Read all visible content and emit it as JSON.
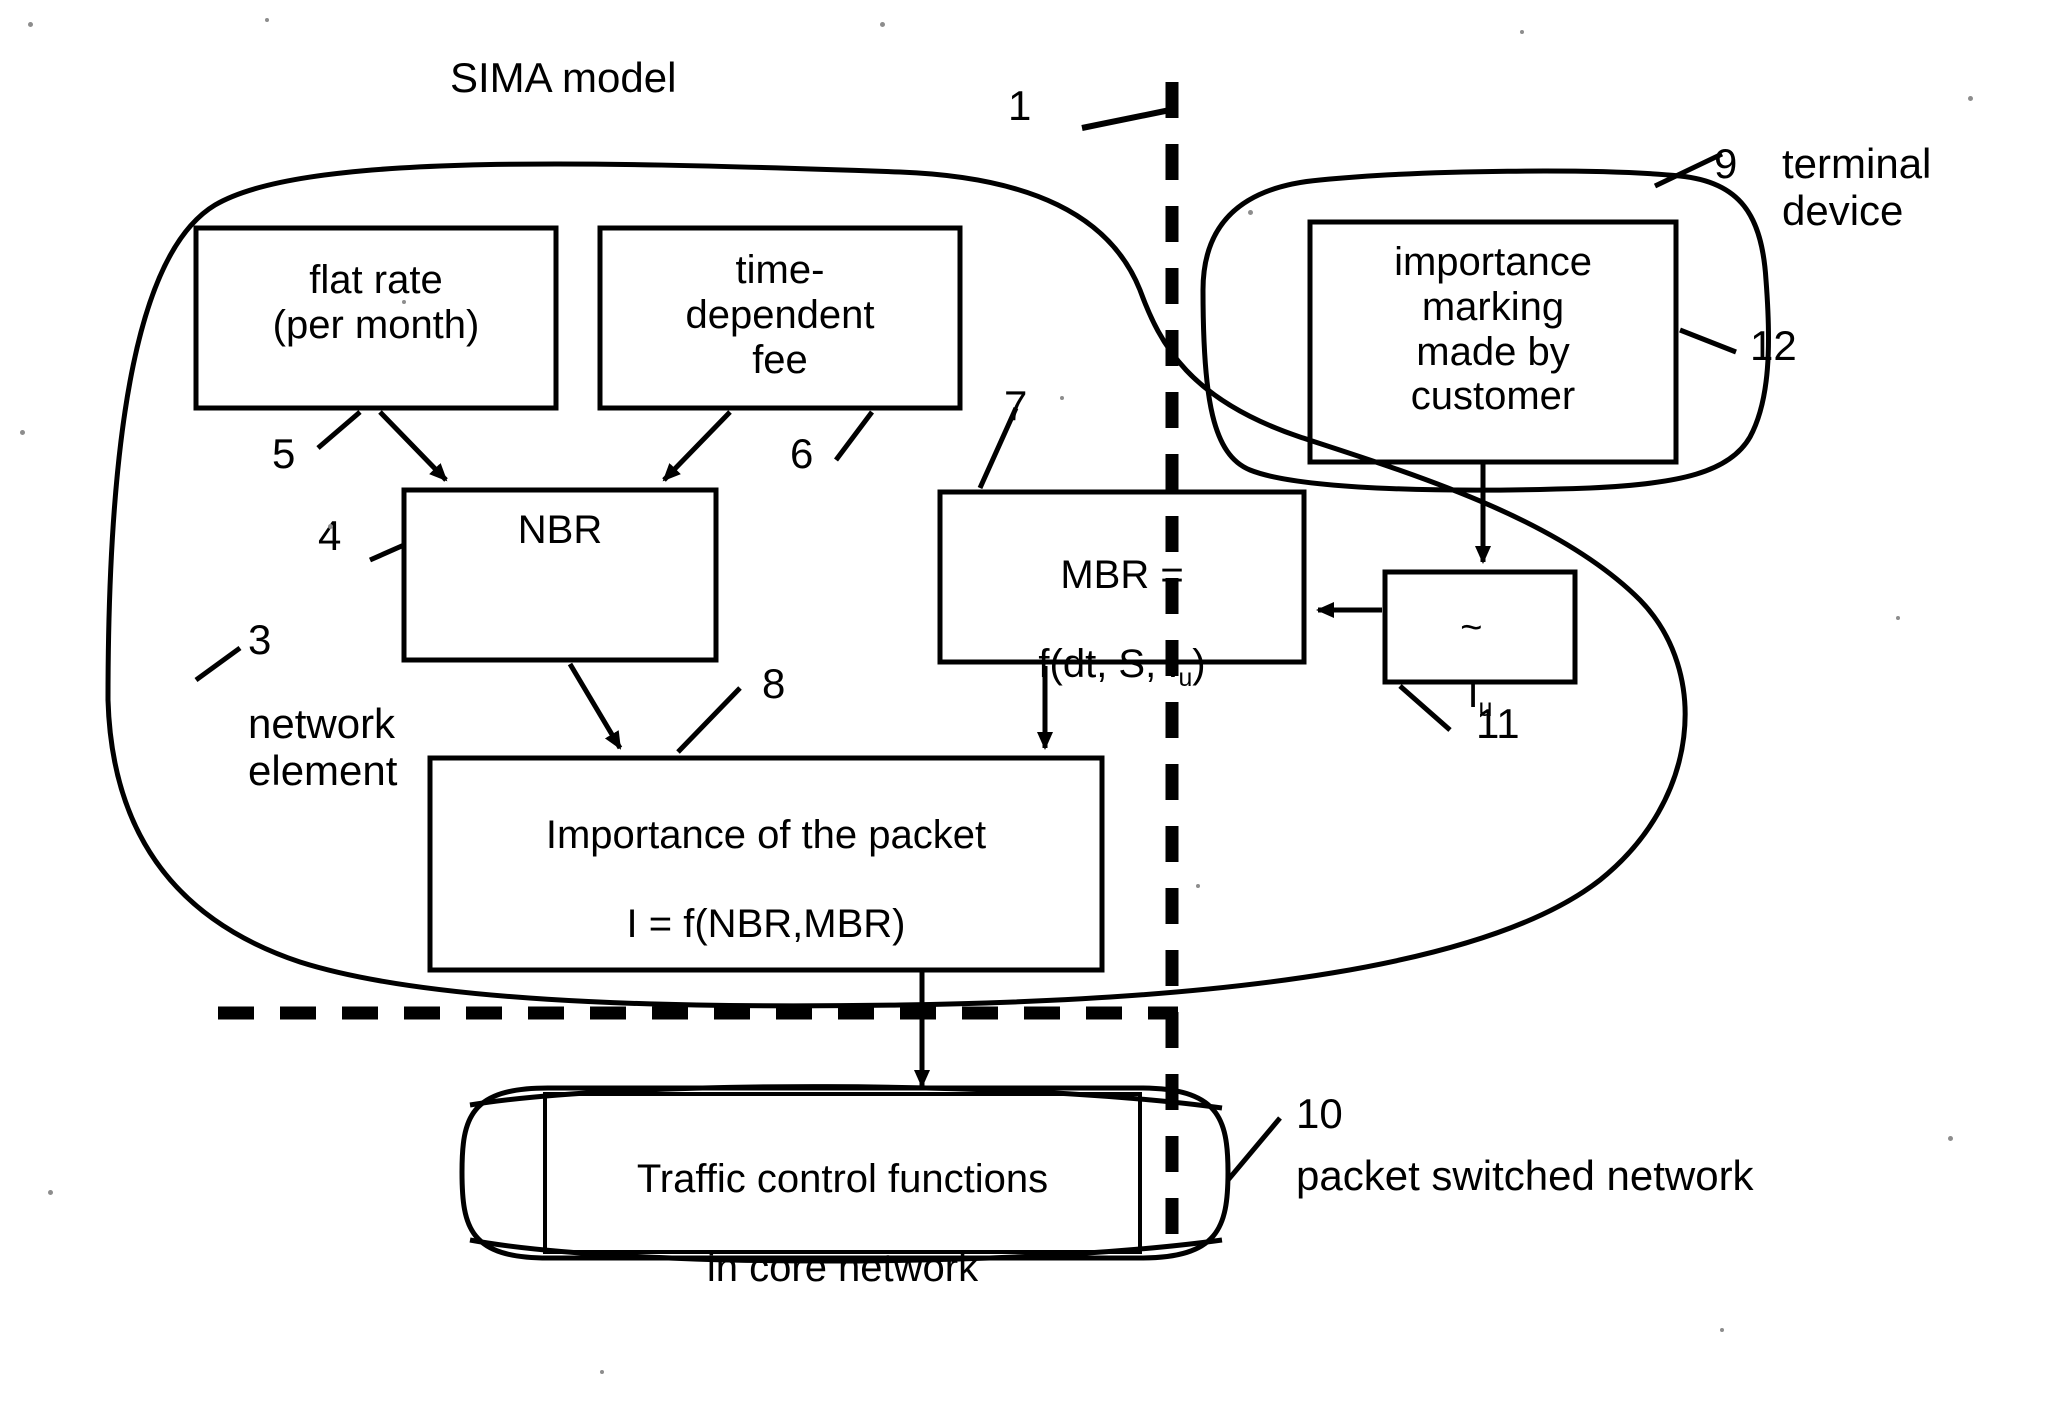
{
  "figure": {
    "title": "SIMA model",
    "type": "block-diagram"
  },
  "labels": {
    "sima_model": "SIMA model",
    "ref_1": "1",
    "ref_3": "3",
    "network_element": "network\nelement",
    "ref_4": "4",
    "ref_5": "5",
    "ref_6": "6",
    "ref_7": "7",
    "ref_8": "8",
    "ref_9": "9",
    "terminal_device": "terminal\ndevice",
    "ref_10": "10",
    "packet_switched_network": "packet switched network",
    "ref_11": "11",
    "ref_12": "12"
  },
  "boxes": {
    "flat_rate": {
      "text": "flat rate\n(per month)",
      "ref": "5"
    },
    "time_dependent_fee": {
      "text": "time-\ndependent\nfee",
      "ref": "6"
    },
    "nbr": {
      "text": "NBR",
      "ref": "4"
    },
    "mbr": {
      "line1": "MBR =",
      "line2_prefix": "f(dt, S,",
      "line2_symbol": "I",
      "line2_sub": "u",
      "line2_suffix": ")",
      "ref": "7"
    },
    "importance_packet": {
      "line1": "Importance of the packet",
      "line2": "I = f(NBR,MBR)",
      "ref": "8"
    },
    "importance_marking": {
      "text": "importance\nmarking\nmade by\ncustomer",
      "ref": "12"
    },
    "iu_tilde": {
      "symbol": "I",
      "tilde": "~",
      "sub": "u",
      "ref": "11"
    },
    "traffic_control": {
      "line1": "Traffic control functions",
      "line2": "in core network",
      "ref": "10"
    }
  },
  "regions": {
    "network_element_blob": "network element",
    "terminal_device_blob": "terminal device",
    "packet_switched_network_blob": "packet switched network"
  },
  "colors": {
    "stroke": "#000000",
    "background": "#ffffff",
    "speck": "#8d8d8d"
  }
}
